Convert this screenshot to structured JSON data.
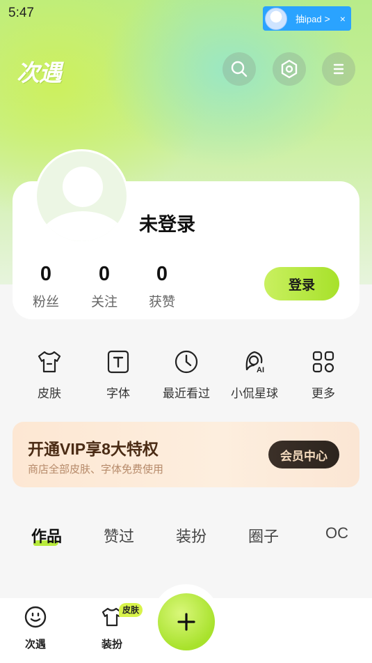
{
  "status_bar": {
    "time": "5:47"
  },
  "floating_widget": {
    "text": "抽ipad",
    "arrow": ">",
    "close": "×"
  },
  "header": {
    "logo_text": "次遇"
  },
  "profile": {
    "username": "未登录",
    "stats": [
      {
        "value": "0",
        "label": "粉丝"
      },
      {
        "value": "0",
        "label": "关注"
      },
      {
        "value": "0",
        "label": "获赞"
      }
    ],
    "login_label": "登录"
  },
  "quick_actions": [
    {
      "label": "皮肤",
      "icon": "tshirt-icon"
    },
    {
      "label": "字体",
      "icon": "font-icon"
    },
    {
      "label": "最近看过",
      "icon": "clock-icon"
    },
    {
      "label": "小侃星球",
      "icon": "ai-avatar-icon"
    },
    {
      "label": "更多",
      "icon": "grid-icon"
    }
  ],
  "vip": {
    "title": "开通VIP享8大特权",
    "subtitle": "商店全部皮肤、字体免费使用",
    "button_label": "会员中心"
  },
  "tabs": [
    {
      "label": "作品",
      "active": true
    },
    {
      "label": "赞过",
      "active": false
    },
    {
      "label": "装扮",
      "active": false
    },
    {
      "label": "圈子",
      "active": false
    },
    {
      "label": "OC",
      "active": false
    }
  ],
  "bottom_nav": {
    "items": [
      {
        "label": "次遇",
        "icon": "smile-icon"
      },
      {
        "label": "装扮",
        "icon": "tshirt-icon",
        "badge": "皮肤"
      }
    ],
    "fab_icon": "plus-icon"
  },
  "colors": {
    "accent": "#a7e12a",
    "vip_text": "#4a2b14"
  }
}
